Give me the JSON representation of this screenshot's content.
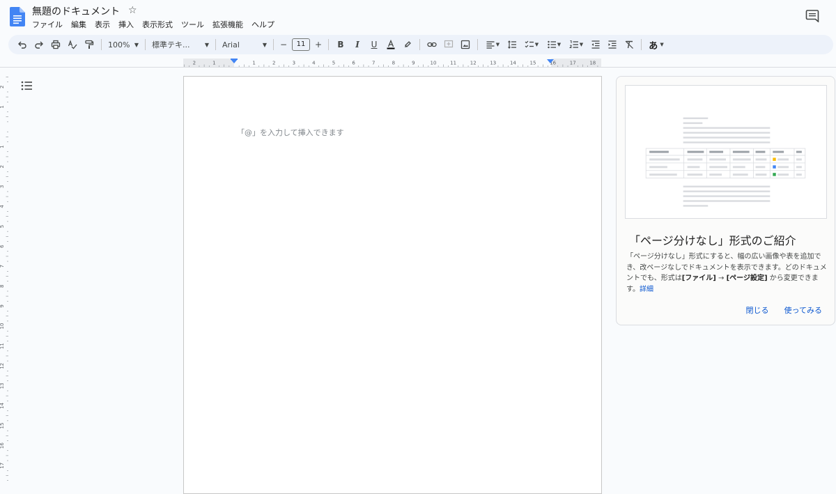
{
  "app": {
    "doc_title": "無題のドキュメント",
    "menu": [
      "ファイル",
      "編集",
      "表示",
      "挿入",
      "表示形式",
      "ツール",
      "拡張機能",
      "ヘルプ"
    ]
  },
  "toolbar": {
    "zoom": "100%",
    "style": "標準テキ...",
    "font": "Arial",
    "font_size": "11",
    "input_tools_label": "あ",
    "colors": {
      "text_color_bar": "#000000",
      "accent": "#0b57d0"
    }
  },
  "rulers": {
    "horizontal_labels": [
      "2",
      "1",
      "1",
      "2",
      "3",
      "4",
      "5",
      "6",
      "7",
      "8",
      "9",
      "10",
      "11",
      "12",
      "13",
      "14",
      "15",
      "16",
      "17",
      "18"
    ],
    "vertical_labels": [
      "2",
      "1",
      "1",
      "2",
      "3",
      "4",
      "5",
      "6",
      "7",
      "8",
      "9",
      "10",
      "11",
      "12",
      "13",
      "14",
      "15",
      "16",
      "17"
    ]
  },
  "document": {
    "placeholder": "「@」を入力して挿入できます"
  },
  "pageless_card": {
    "title": "「ページ分けなし」形式のご紹介",
    "body_prefix": "「ページ分けなし」形式にすると、幅の広い画像や表を追加でき、改ページなしでドキュメントを表示できます。どのドキュメントでも、形式は",
    "menu_file": "[ファイル]",
    "arrow": " → ",
    "menu_page_setup": "[ページ設定]",
    "body_suffix": " から変更できます。",
    "learn_more": "詳細",
    "close_label": "閉じる",
    "try_label": "使ってみる"
  },
  "icons": [
    "docs-logo-icon",
    "star-icon",
    "comment-icon",
    "undo-icon",
    "redo-icon",
    "print-icon",
    "spellcheck-icon",
    "paint-format-icon",
    "bold-icon",
    "italic-icon",
    "underline-icon",
    "text-color-icon",
    "highlight-icon",
    "link-icon",
    "add-comment-icon",
    "image-icon",
    "align-icon",
    "line-spacing-icon",
    "checklist-icon",
    "bulleted-list-icon",
    "numbered-list-icon",
    "decrease-indent-icon",
    "increase-indent-icon",
    "clear-formatting-icon",
    "outline-icon"
  ]
}
